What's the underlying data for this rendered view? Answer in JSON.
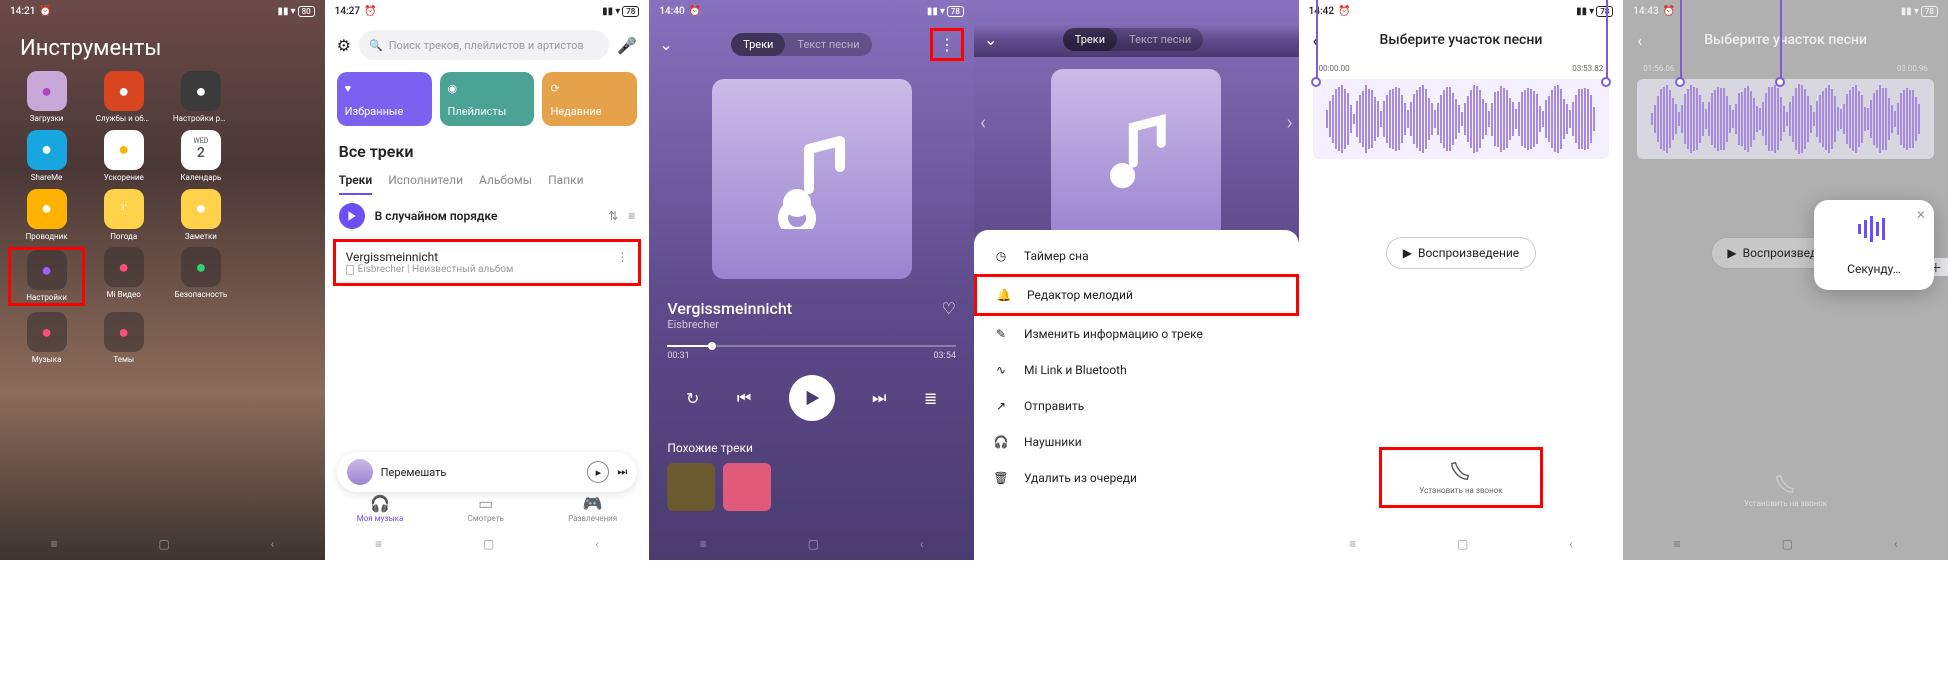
{
  "screen1": {
    "status_time": "14:21",
    "folder_title": "Инструменты",
    "apps": [
      {
        "label": "Загрузки",
        "bg": "#c8a8d8",
        "fg": "#b23fbf"
      },
      {
        "label": "Службы и обратная св…",
        "bg": "#d8461f",
        "fg": "#fff"
      },
      {
        "label": "Настройки рабочего ст…",
        "bg": "#3b3b3b",
        "fg": "#fff"
      },
      {
        "label": "",
        "bg": "transparent",
        "fg": ""
      },
      {
        "label": "ShareMe",
        "bg": "#17a6e0",
        "fg": "#fff"
      },
      {
        "label": "Ускорение",
        "bg": "#fff",
        "fg": "#ffb300"
      },
      {
        "label": "Календарь",
        "bg": "#fff",
        "fg": "#555",
        "text": "WED",
        "num": "2"
      },
      {
        "label": "",
        "bg": "transparent",
        "fg": ""
      },
      {
        "label": "Проводник",
        "bg": "#ffb300",
        "fg": "#fff"
      },
      {
        "label": "Погода",
        "bg": "#ffd24a",
        "fg": "#fff",
        "text": "3°"
      },
      {
        "label": "Заметки",
        "bg": "#ffd24a",
        "fg": "#fff"
      },
      {
        "label": "",
        "bg": "transparent",
        "fg": ""
      },
      {
        "label": "Настройки",
        "bg": "rgba(60,50,50,.6)",
        "fg": "#a05fff"
      },
      {
        "label": "Mi Видео",
        "bg": "rgba(60,50,50,.6)",
        "fg": "#ff4f7a"
      },
      {
        "label": "Безопасность",
        "bg": "rgba(60,50,50,.6)",
        "fg": "#2fd47a"
      },
      {
        "label": "",
        "bg": "transparent",
        "fg": ""
      },
      {
        "label": "Музыка",
        "bg": "rgba(60,50,50,.6)",
        "fg": "#ff4f7a"
      },
      {
        "label": "Темы",
        "bg": "rgba(60,50,50,.6)",
        "fg": "#ff4f7a"
      }
    ],
    "highlight_index": 12
  },
  "screen2": {
    "status_time": "14:27",
    "search_placeholder": "Поиск треков, плейлистов и артистов",
    "tiles": [
      {
        "label": "Избранные",
        "bg": "#7b61f0"
      },
      {
        "label": "Плейлисты",
        "bg": "#4aa394"
      },
      {
        "label": "Недавние",
        "bg": "#e6a24a"
      }
    ],
    "section_title": "Все треки",
    "tabs": [
      "Треки",
      "Исполнители",
      "Альбомы",
      "Папки"
    ],
    "active_tab": 0,
    "shuffle_label": "В случайном порядке",
    "track": {
      "title": "Vergissmeinnicht",
      "meta": "Eisbrecher | Неизвестный альбом"
    },
    "minibar_label": "Перемешать",
    "bottom_nav": [
      "Моя музыка",
      "Смотреть",
      "Развлечения"
    ]
  },
  "screen3": {
    "status_time": "14:40",
    "pill": [
      "Треки",
      "Текст песни"
    ],
    "active_pill": 0,
    "song_title": "Vergissmeinnicht",
    "song_artist": "Eisbrecher",
    "time_cur": "00:31",
    "time_tot": "03:54",
    "similar": "Похожие треки"
  },
  "screen4": {
    "pill": [
      "Треки",
      "Текст песни"
    ],
    "active_pill": 0,
    "menu": [
      "Таймер сна",
      "Редактор мелодий",
      "Изменить информацию о треке",
      "Mi Link и Bluetooth",
      "Отправить",
      "Наушники",
      "Удалить из очереди"
    ],
    "highlight_index": 1
  },
  "screen5": {
    "status_time": "14:42",
    "title": "Выберите участок песни",
    "t_start": "00:00.00",
    "t_end": "03:53.82",
    "play_label": "Воспроизведение",
    "ring_label": "Установить на звонок"
  },
  "screen6": {
    "status_time": "14:43",
    "title": "Выберите участок песни",
    "t_start": "01:56.06",
    "t_end": "03:00.96",
    "play_label": "Воспроизведение",
    "ring_label": "Установить на звонок",
    "dialog_text": "Секунду…"
  }
}
